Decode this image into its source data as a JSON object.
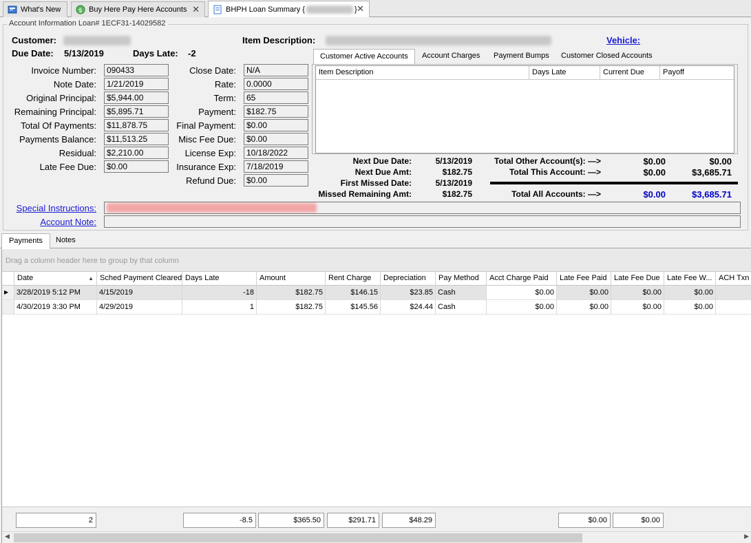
{
  "tabs": [
    {
      "label": "What's New"
    },
    {
      "label": "Buy Here Pay Here Accounts"
    },
    {
      "label": "BHPH Loan Summary {",
      "suffix": "}"
    }
  ],
  "group_title": "Account Information Loan# 1ECF31-14029582",
  "header": {
    "customer_label": "Customer:",
    "item_description_label": "Item Description:",
    "vehicle_link": "Vehicle:",
    "due_date_label": "Due Date:",
    "due_date": "5/13/2019",
    "days_late_label": "Days Late:",
    "days_late": "-2"
  },
  "left_fields": [
    {
      "label": "Invoice Number:",
      "value": "090433"
    },
    {
      "label": "Note Date:",
      "value": "1/21/2019"
    },
    {
      "label": "Original Principal:",
      "value": "$5,944.00"
    },
    {
      "label": "Remaining Principal:",
      "value": "$5,895.71"
    },
    {
      "label": "Total Of Payments:",
      "value": "$11,878.75"
    },
    {
      "label": "Payments Balance:",
      "value": "$11,513.25"
    },
    {
      "label": "Residual:",
      "value": "$2,210.00"
    },
    {
      "label": "Late Fee Due:",
      "value": "$0.00"
    }
  ],
  "mid_fields": [
    {
      "label": "Close Date:",
      "value": "N/A"
    },
    {
      "label": "Rate:",
      "value": "0.0000"
    },
    {
      "label": "Term:",
      "value": "65"
    },
    {
      "label": "Payment:",
      "value": "$182.75"
    },
    {
      "label": "Final Payment:",
      "value": "$0.00"
    },
    {
      "label": "Misc Fee Due:",
      "value": "$0.00"
    },
    {
      "label": "License Exp:",
      "value": "10/18/2022"
    },
    {
      "label": "Insurance Exp:",
      "value": "7/18/2019"
    },
    {
      "label": "Refund Due:",
      "value": "$0.00"
    }
  ],
  "special_instructions_link": "Special Instructions:",
  "account_note_link": "Account Note:",
  "inner_tabs": [
    "Customer Active Accounts",
    "Account Charges",
    "Payment Bumps",
    "Customer Closed Accounts"
  ],
  "inner_grid_headers": [
    "Item Description",
    "Days Late",
    "Current Due",
    "Payoff"
  ],
  "summary": {
    "next_due_date_label": "Next Due Date:",
    "next_due_date": "5/13/2019",
    "next_due_amt_label": "Next Due Amt:",
    "next_due_amt": "$182.75",
    "first_missed_label": "First Missed Date:",
    "first_missed": "5/13/2019",
    "missed_remaining_label": "Missed Remaining Amt:",
    "missed_remaining": "$182.75",
    "total_other_label": "Total Other Account(s): —>",
    "total_other_a": "$0.00",
    "total_other_b": "$0.00",
    "total_this_label": "Total This Account: —>",
    "total_this_a": "$0.00",
    "total_this_b": "$3,685.71",
    "total_all_label": "Total All Accounts: —>",
    "total_all_a": "$0.00",
    "total_all_b": "$3,685.71",
    "blue_color": "#0000cc"
  },
  "lower_tabs": [
    "Payments",
    "Notes"
  ],
  "group_panel_text": "Drag a column header here to group by that column",
  "grid_headers": [
    "Date",
    "Sched Payment Cleared",
    "Days Late",
    "Amount",
    "Rent Charge",
    "Depreciation",
    "Pay Method",
    "Acct Charge Paid",
    "Late Fee Paid",
    "Late Fee Due",
    "Late Fee W...",
    "ACH Txn F"
  ],
  "rows": [
    [
      "3/28/2019 5:12 PM",
      "4/15/2019",
      "-18",
      "$182.75",
      "$146.15",
      "$23.85",
      "Cash",
      "$0.00",
      "$0.00",
      "$0.00",
      "$0.00",
      ""
    ],
    [
      "4/30/2019 3:30 PM",
      "4/29/2019",
      "1",
      "$182.75",
      "$145.56",
      "$24.44",
      "Cash",
      "$0.00",
      "$0.00",
      "$0.00",
      "$0.00",
      ""
    ]
  ],
  "footer": {
    "count": "2",
    "days_late": "-8.5",
    "amount": "$365.50",
    "rent_charge": "$291.71",
    "depreciation": "$48.29",
    "late_fee_paid": "$0.00",
    "late_fee_due": "$0.00"
  }
}
